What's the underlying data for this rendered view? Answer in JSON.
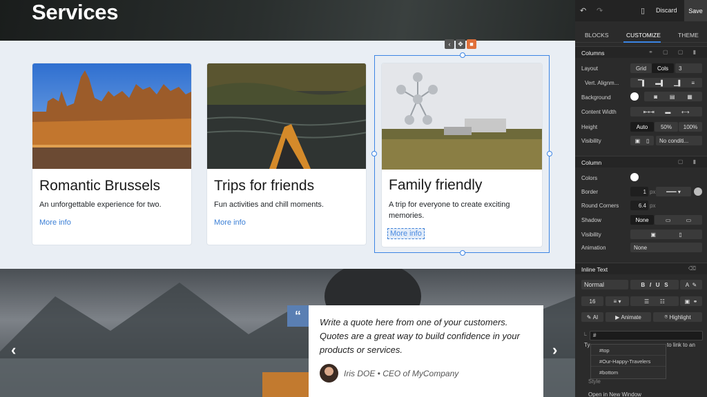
{
  "canvas": {
    "hero_title": "Services",
    "cards": [
      {
        "title": "Romantic Brussels",
        "text": "An unforgettable experience for two.",
        "link": "More info"
      },
      {
        "title": "Trips for friends",
        "text": "Fun activities and chill moments.",
        "link": "More info"
      },
      {
        "title": "Family friendly",
        "text": "A trip for everyone to create exciting memories.",
        "link": "More info"
      }
    ],
    "quote": {
      "mark": "“",
      "text": "Write a quote here from one of your customers. Quotes are a great way to build confidence in your products or services.",
      "author": "Iris DOE • CEO of MyCompany"
    },
    "carousel": {
      "prev": "‹",
      "next": "›"
    }
  },
  "panel": {
    "undo_icon": "undo-icon",
    "redo_icon": "redo-icon",
    "discard": "Discard",
    "save": "Save",
    "tabs": [
      "BLOCKS",
      "CUSTOMIZE",
      "THEME"
    ],
    "columns_section": {
      "title": "Columns",
      "layout_label": "Layout",
      "layout_options": [
        "Grid",
        "Cols"
      ],
      "cols_value": "3",
      "valign_label": "Vert. Alignm...",
      "background_label": "Background",
      "content_width_label": "Content Width",
      "height_label": "Height",
      "height_options": [
        "Auto",
        "50%",
        "100%"
      ],
      "visibility_label": "Visibility",
      "visibility_value": "No conditi..."
    },
    "column_section": {
      "title": "Column",
      "colors_label": "Colors",
      "border_label": "Border",
      "border_value": "1",
      "border_unit": "px",
      "round_label": "Round Corners",
      "round_value": "6.4",
      "round_unit": "px",
      "shadow_label": "Shadow",
      "shadow_value": "None",
      "visibility_label": "Visibility",
      "animation_label": "Animation",
      "animation_value": "None"
    },
    "inline_section": {
      "title": "Inline Text",
      "style_value": "Normal",
      "font_size": "16",
      "ai_label": "AI",
      "animate_label": "Animate",
      "highlight_label": "Highlight",
      "link_value": "#",
      "behind_text_1": "Ty",
      "behind_text_2": "to link to an",
      "behind_text_3": "Style",
      "open_new_window": "Open in New Window",
      "dropdown_options": [
        "#top",
        "#Our-Happy-Travelers",
        "#bottom"
      ]
    }
  }
}
